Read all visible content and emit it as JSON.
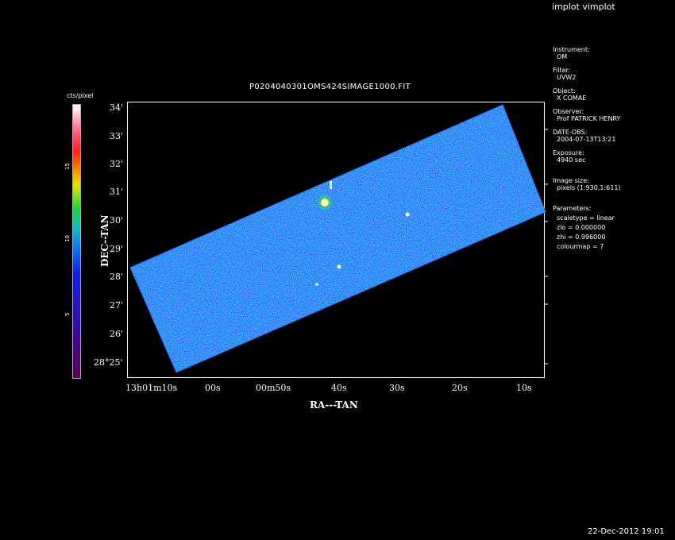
{
  "header": {
    "app_title": "implot vimplot"
  },
  "plot": {
    "title": "P0204040301OMS424SIMAGE1000.FIT",
    "xlabel": "RA---TAN",
    "ylabel": "DEC--TAN",
    "colorbar_label": "cts/pixel",
    "colorbar_ticks": [
      "5",
      "10",
      "15"
    ],
    "y_ticks": [
      "34'",
      "33'",
      "32'",
      "31'",
      "30'",
      "29'",
      "28'",
      "27'",
      "26'",
      "28°25'"
    ],
    "x_ticks": [
      "13h01m10s",
      "00s",
      "00m50s",
      "40s",
      "30s",
      "20s",
      "10s"
    ]
  },
  "info": {
    "instrument_label": "Instrument:",
    "instrument": "OM",
    "filter_label": "Filter:",
    "filter": "UVW2",
    "object_label": "Object:",
    "object": "X COMAE",
    "observer_label": "Observer:",
    "observer": "Prof PATRICK HENRY",
    "date_label": "DATE-OBS:",
    "date": "2004-07-13T13:21",
    "exposure_label": "Exposure:",
    "exposure": "4940 sec",
    "size_label": "Image size:",
    "size": "pixels (1:930,1:611)",
    "params_label": "Parameters:",
    "scaletype": "scaletype = linear",
    "zlo": "zlo = 0.000000",
    "zhi": "zhi = 0.996000",
    "colourmap": "colourmap =   7"
  },
  "footer": {
    "timestamp": "22-Dec-2012 19:01"
  },
  "colors": {
    "background": "#000000",
    "frame": "#ffffff",
    "field": "#1a5cf0"
  }
}
